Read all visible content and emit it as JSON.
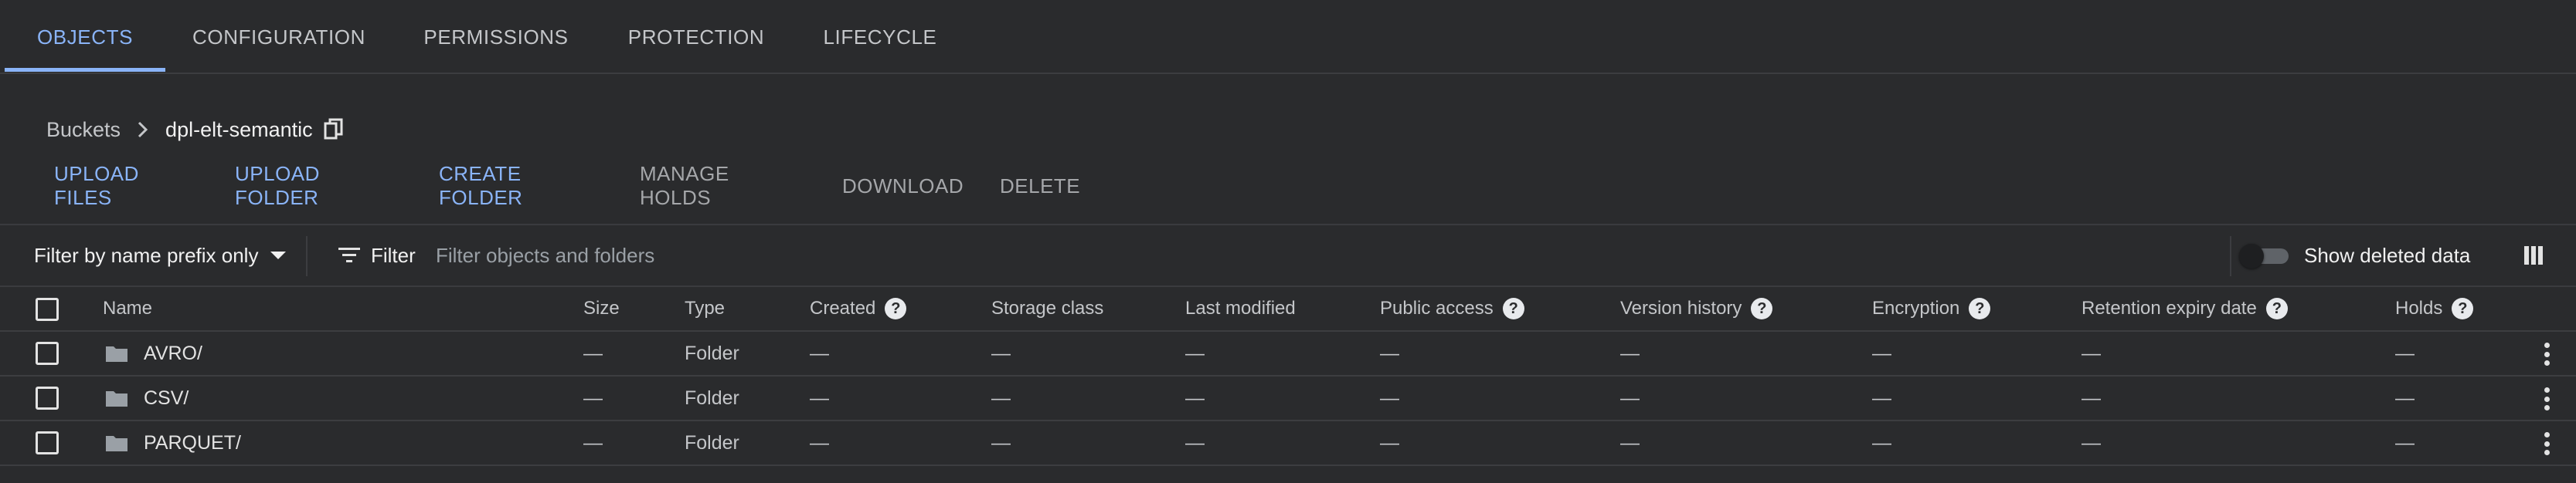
{
  "tabs": {
    "objects": "OBJECTS",
    "configuration": "CONFIGURATION",
    "permissions": "PERMISSIONS",
    "protection": "PROTECTION",
    "lifecycle": "LIFECYCLE",
    "active": "OBJECTS"
  },
  "breadcrumb": {
    "root": "Buckets",
    "current": "dpl-elt-semantic"
  },
  "actions": {
    "upload_files": "UPLOAD FILES",
    "upload_folder": "UPLOAD FOLDER",
    "create_folder": "CREATE FOLDER",
    "manage_holds": "MANAGE HOLDS",
    "download": "DOWNLOAD",
    "delete": "DELETE"
  },
  "filterbar": {
    "prefix_mode": "Filter by name prefix only",
    "filter_label": "Filter",
    "placeholder": "Filter objects and folders",
    "show_deleted_label": "Show deleted data",
    "show_deleted_on": false
  },
  "table": {
    "headers": {
      "name": "Name",
      "size": "Size",
      "type": "Type",
      "created": "Created",
      "storage_class": "Storage class",
      "last_modified": "Last modified",
      "public_access": "Public access",
      "version_history": "Version history",
      "encryption": "Encryption",
      "retention_expiry": "Retention expiry date",
      "holds": "Holds"
    },
    "help_glyph": "?",
    "rows": [
      {
        "name": "AVRO/",
        "size": "—",
        "type": "Folder",
        "created": "—",
        "storage_class": "—",
        "last_modified": "—",
        "public_access": "—",
        "version_history": "—",
        "encryption": "—",
        "retention_expiry": "—",
        "holds": "—"
      },
      {
        "name": "CSV/",
        "size": "—",
        "type": "Folder",
        "created": "—",
        "storage_class": "—",
        "last_modified": "—",
        "public_access": "—",
        "version_history": "—",
        "encryption": "—",
        "retention_expiry": "—",
        "holds": "—"
      },
      {
        "name": "PARQUET/",
        "size": "—",
        "type": "Folder",
        "created": "—",
        "storage_class": "—",
        "last_modified": "—",
        "public_access": "—",
        "version_history": "—",
        "encryption": "—",
        "retention_expiry": "—",
        "holds": "—"
      }
    ]
  },
  "colors": {
    "background": "#2a2b2d",
    "accent": "#8ab4f8",
    "text": "#e3e3e3",
    "muted": "#c4c6c9"
  },
  "icons": [
    "chevron-right-icon",
    "copy-icon",
    "filter-icon",
    "column-display-icon",
    "folder-icon",
    "more-vert-icon",
    "help-icon"
  ]
}
